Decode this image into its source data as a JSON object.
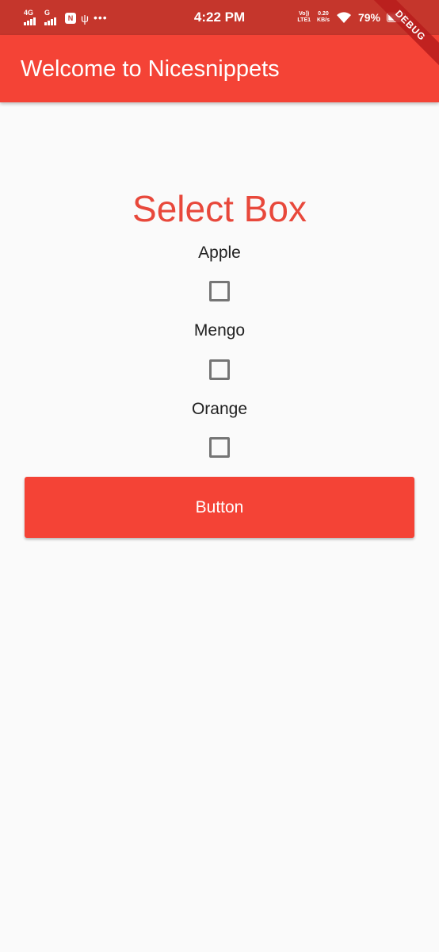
{
  "status_bar": {
    "network_1": "4G",
    "network_2": "G",
    "app_badge": "N",
    "time": "4:22 PM",
    "volte_line1": "Vo))",
    "volte_line2": "LTE1",
    "speed_value": "0.20",
    "speed_unit": "KB/s",
    "battery_percent": "79%",
    "battery_level": 0.79
  },
  "debug_banner": "DEBUG",
  "app_bar": {
    "title": "Welcome to Nicesnippets"
  },
  "main": {
    "heading": "Select Box",
    "options": [
      {
        "label": "Apple",
        "checked": false
      },
      {
        "label": "Mengo",
        "checked": false
      },
      {
        "label": "Orange",
        "checked": false
      }
    ],
    "button_label": "Button"
  },
  "colors": {
    "primary": "#f44336",
    "status_bar": "#c5362c",
    "heading": "#e8483b",
    "background": "#fafafa",
    "checkbox_border": "#757575"
  }
}
